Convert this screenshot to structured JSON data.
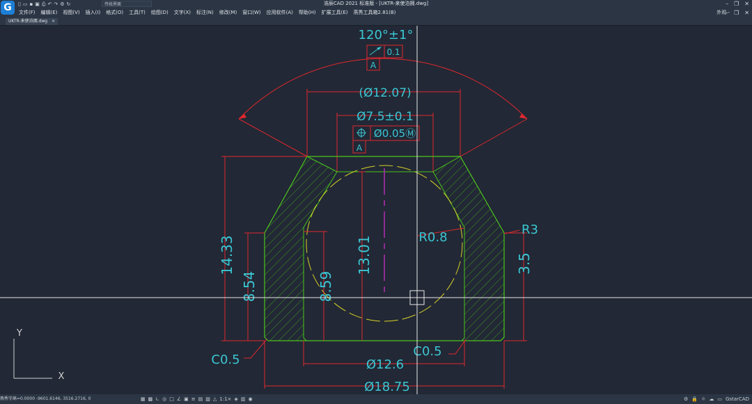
{
  "app": {
    "logo_letter": "G",
    "title": "浩辰CAD 2021 标准版 - [UKTR-来使泊拥.dwg]",
    "workspace": "传统界面"
  },
  "menu": [
    "文件(F)",
    "编辑(E)",
    "视图(V)",
    "插入(I)",
    "格式(O)",
    "工具(T)",
    "绘图(D)",
    "文字(X)",
    "标注(N)",
    "修改(M)",
    "窗口(W)",
    "应用软件(A)",
    "帮助(H)",
    "扩展工具(E)",
    "燕秀工具箱2.81(B)"
  ],
  "appearance_label": "外观 -",
  "tab": {
    "label": "UKTR-来使泊拥.dwg",
    "close": "×"
  },
  "drawing": {
    "dims": {
      "angle": "120°±1°",
      "gdt1_value": "0.1",
      "gdt_datum": "A",
      "d_12_07": "(Ø12.07)",
      "d_7_5": "Ø7.5±0.1",
      "gdt2_value": "Ø0.05Ⓜ",
      "h_14_33": "14.33",
      "h_8_54": "8.54",
      "h_8_59": "8.59",
      "h_13_01": "13.01",
      "r_0_8": "R0.8",
      "r_3": "R3",
      "h_3_5": "3.5",
      "c_left": "C0.5",
      "c_right": "C0.5",
      "d_12_6": "Ø12.6",
      "d_18_75": "Ø18.75"
    },
    "ucs": {
      "y": "Y",
      "x": "X"
    }
  },
  "status": {
    "coords": "燕秀字高=0.0000  -9601.6146, 3516.2716, 0",
    "zoom": "1:1×",
    "brand": "GstarCAD"
  },
  "colors": {
    "background": "#222835",
    "dimension": "#e0282e",
    "dim_text": "#3cc6d3",
    "outline": "#4cc51d",
    "hatch": "#3f9d1f",
    "circle": "#d7d128",
    "centerline": "#b52db5",
    "crosshair": "#e8e8e8"
  }
}
